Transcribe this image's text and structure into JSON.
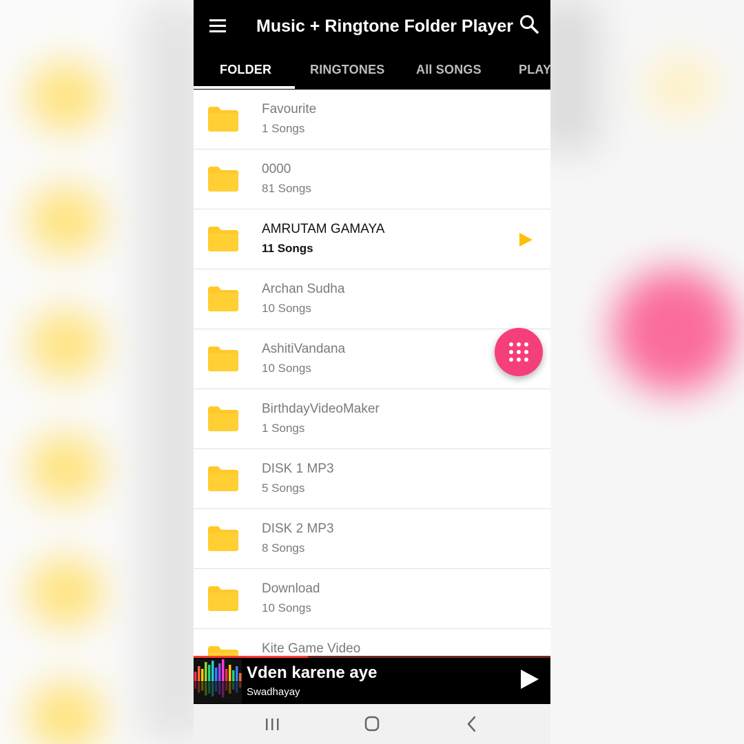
{
  "app": {
    "title": "Music + Ringtone Folder Player",
    "menu_icon": "hamburger-menu-icon",
    "search_icon": "search-icon"
  },
  "tabs": [
    {
      "label": "FOLDER",
      "active": true
    },
    {
      "label": "RINGTONES",
      "active": false
    },
    {
      "label": "All SONGS",
      "active": false
    },
    {
      "label": "PLAYLIST",
      "active": false
    }
  ],
  "folders": [
    {
      "name": "Favourite",
      "count": "1   Songs",
      "playing": false
    },
    {
      "name": "0000",
      "count": "81 Songs",
      "playing": false
    },
    {
      "name": "AMRUTAM GAMAYA",
      "count": "11 Songs",
      "playing": true
    },
    {
      "name": "Archan Sudha",
      "count": "10 Songs",
      "playing": false
    },
    {
      "name": "AshitiVandana",
      "count": "10 Songs",
      "playing": false
    },
    {
      "name": "BirthdayVideoMaker",
      "count": "1 Songs",
      "playing": false
    },
    {
      "name": "DISK 1 MP3",
      "count": "5 Songs",
      "playing": false
    },
    {
      "name": "DISK 2 MP3",
      "count": "8 Songs",
      "playing": false
    },
    {
      "name": "Download",
      "count": "10 Songs",
      "playing": false
    },
    {
      "name": "Kite Game Video",
      "count": "",
      "playing": false
    }
  ],
  "fab": {
    "icon": "grid-dots-icon"
  },
  "now_playing": {
    "title": "Vden karene aye",
    "artist": "Swadhayay",
    "progress": 0.32,
    "play_icon": "play-icon"
  },
  "colors": {
    "appbar": "#000000",
    "folder": "#ffc928",
    "accent_play": "#ffc107",
    "fab": "#f53f7a",
    "progress": "#ff3b2f"
  },
  "system_nav": {
    "recents_icon": "recents-icon",
    "home_icon": "home-icon",
    "back_icon": "back-icon"
  }
}
